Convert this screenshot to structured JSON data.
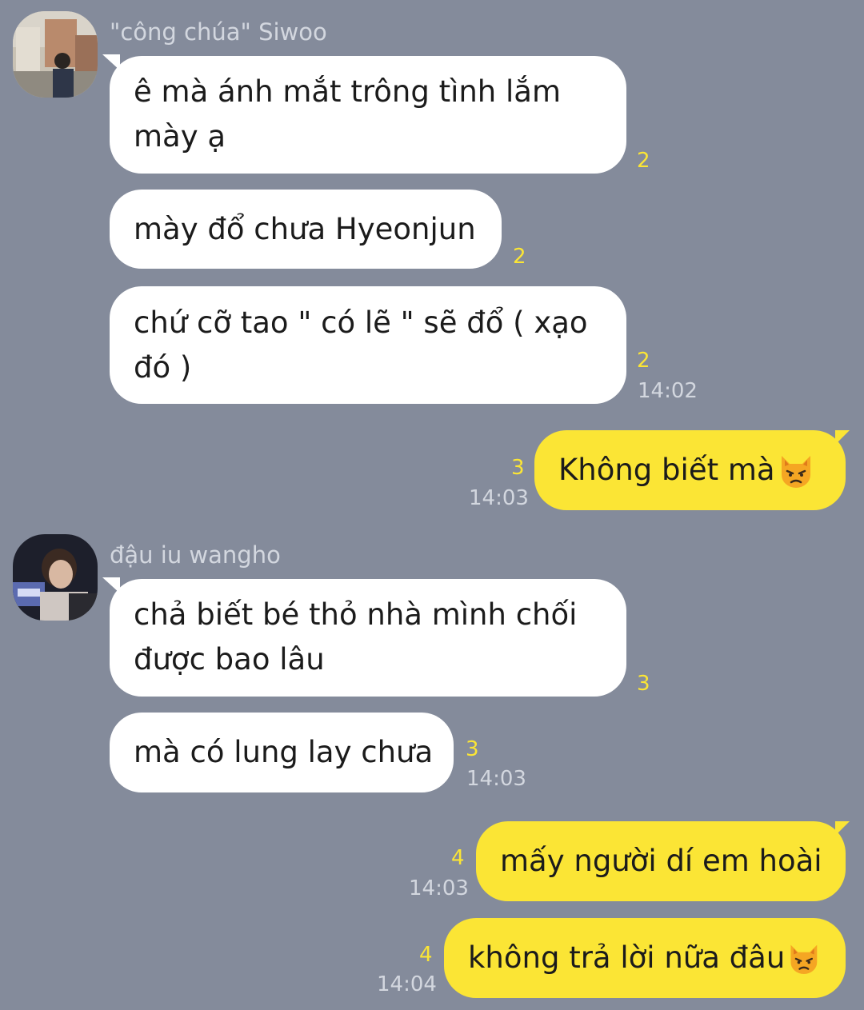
{
  "colors": {
    "background": "#848b9b",
    "incoming_bubble": "#ffffff",
    "outgoing_bubble": "#fbe535",
    "unread_count": "#fbe535",
    "meta_text": "#d3d7df"
  },
  "groups": [
    {
      "sender": "\"công chúa\" Siwoo",
      "avatar_icon": "profile-photo",
      "messages": [
        {
          "text1": "ê mà ánh mắt trông tình lắm",
          "text2": "mày ạ",
          "unread": "2",
          "time": ""
        },
        {
          "text1": "mày đổ chưa Hyeonjun",
          "unread": "2",
          "time": ""
        },
        {
          "text1": "chứ cỡ tao \" có lẽ \" sẽ đổ ( xạo",
          "text2": "đó )",
          "unread": "2",
          "time": "14:02"
        }
      ]
    },
    {
      "sender": "",
      "outgoing": true,
      "messages": [
        {
          "text1": "Không biết mà",
          "emoji": "pouting-cat",
          "unread": "3",
          "time": "14:03"
        }
      ]
    },
    {
      "sender": "đậu iu wangho",
      "avatar_icon": "profile-photo",
      "messages": [
        {
          "text1": "chả biết bé thỏ nhà mình chối",
          "text2": "được bao lâu",
          "unread": "3",
          "time": ""
        },
        {
          "text1": "mà có lung lay chưa",
          "unread": "3",
          "time": "14:03"
        }
      ]
    },
    {
      "sender": "",
      "outgoing": true,
      "messages": [
        {
          "text1": "mấy người dí em hoài",
          "unread": "4",
          "time": "14:03"
        },
        {
          "text1": "không trả lời nữa đâu",
          "emoji": "pouting-cat",
          "unread": "4",
          "time": "14:04"
        }
      ]
    }
  ]
}
